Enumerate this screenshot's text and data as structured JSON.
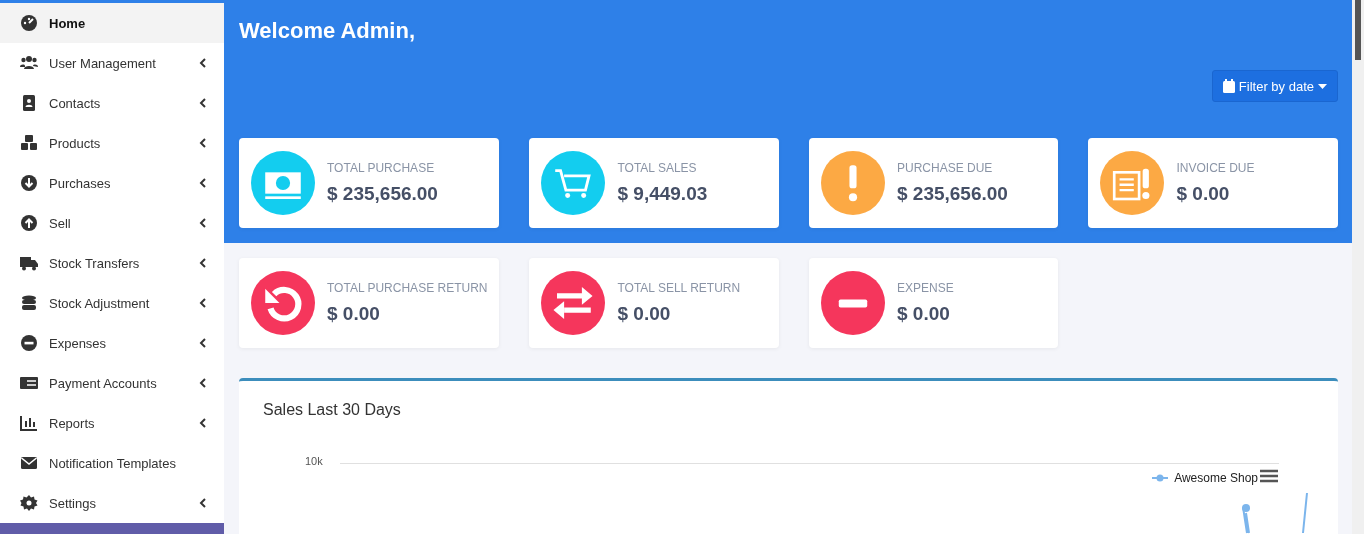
{
  "sidebar": {
    "items": [
      {
        "label": "Home",
        "selected": true,
        "has_submenu": false
      },
      {
        "label": "User Management",
        "selected": false,
        "has_submenu": true
      },
      {
        "label": "Contacts",
        "selected": false,
        "has_submenu": true
      },
      {
        "label": "Products",
        "selected": false,
        "has_submenu": true
      },
      {
        "label": "Purchases",
        "selected": false,
        "has_submenu": true
      },
      {
        "label": "Sell",
        "selected": false,
        "has_submenu": true
      },
      {
        "label": "Stock Transfers",
        "selected": false,
        "has_submenu": true
      },
      {
        "label": "Stock Adjustment",
        "selected": false,
        "has_submenu": true
      },
      {
        "label": "Expenses",
        "selected": false,
        "has_submenu": true
      },
      {
        "label": "Payment Accounts",
        "selected": false,
        "has_submenu": true
      },
      {
        "label": "Reports",
        "selected": false,
        "has_submenu": true
      },
      {
        "label": "Notification Templates",
        "selected": false,
        "has_submenu": false
      },
      {
        "label": "Settings",
        "selected": false,
        "has_submenu": true
      }
    ]
  },
  "header": {
    "title": "Welcome Admin,",
    "filter_button": "Filter by date"
  },
  "cards": [
    {
      "label": "TOTAL PURCHASE",
      "value": "$ 235,656.00",
      "color": "#13cdef"
    },
    {
      "label": "TOTAL SALES",
      "value": "$ 9,449.03",
      "color": "#13cdef"
    },
    {
      "label": "PURCHASE DUE",
      "value": "$ 235,656.00",
      "color": "#fca944"
    },
    {
      "label": "INVOICE DUE",
      "value": "$ 0.00",
      "color": "#fca944"
    },
    {
      "label": "TOTAL PURCHASE RETURN",
      "value": "$ 0.00",
      "color": "#f5365c"
    },
    {
      "label": "TOTAL SELL RETURN",
      "value": "$ 0.00",
      "color": "#f5365c"
    },
    {
      "label": "EXPENSE",
      "value": "$ 0.00",
      "color": "#f5365c"
    }
  ],
  "chart": {
    "title": "Sales Last 30 Days",
    "ytick_label": "10k",
    "legend": "Awesome Shop"
  }
}
